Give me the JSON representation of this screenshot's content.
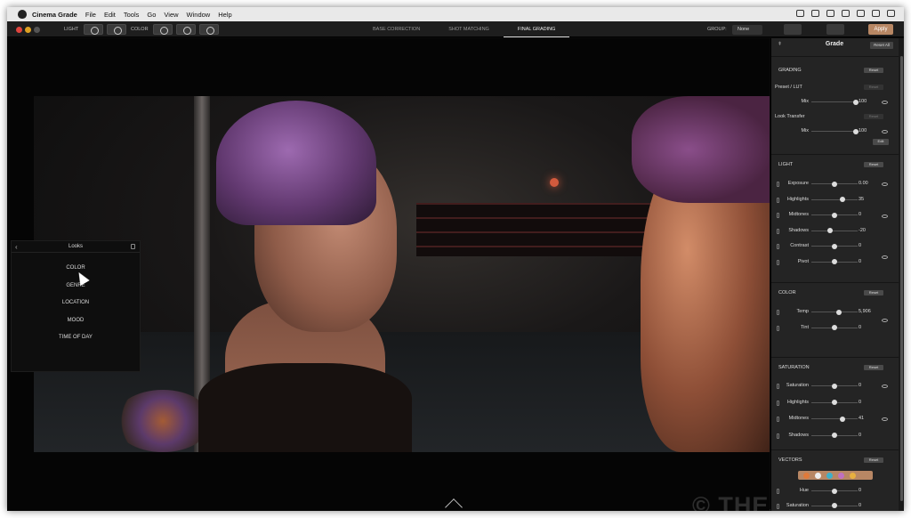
{
  "menubar": {
    "app_name": "Cinema Grade",
    "items": [
      "File",
      "Edit",
      "Tools",
      "Go",
      "View",
      "Window",
      "Help"
    ]
  },
  "toolbar": {
    "light_label": "LIGHT",
    "color_label": "COLOR",
    "tabs": [
      {
        "label": "BASE CORRECTION",
        "active": false
      },
      {
        "label": "SHOT MATCHING",
        "active": false
      },
      {
        "label": "FINAL GRADING",
        "active": true
      }
    ],
    "group_label": "GROUP:",
    "group_value": "None",
    "apply_label": "Apply"
  },
  "looks": {
    "title": "Looks",
    "items": [
      "COLOR",
      "GENRE",
      "LOCATION",
      "MOOD",
      "TIME OF DAY"
    ]
  },
  "watermark": "© THESOFTWARE",
  "panel": {
    "title": "Grade",
    "reset_all": "Reset All",
    "grading": {
      "title": "GRADING",
      "reset": "Reset",
      "preset_lut": "Preset / LUT",
      "preset_reset": "Reset",
      "mix_label": "Mix",
      "mix_value": "100",
      "mix_fraction": 0.96,
      "look_transfer": "Look Transfer",
      "lt_reset": "Reset",
      "lt_mix_label": "Mix",
      "lt_mix_value": "100",
      "lt_mix_fraction": 0.96,
      "edit": "Edit"
    },
    "light": {
      "title": "LIGHT",
      "reset": "Reset",
      "rows": [
        {
          "label": "Exposure",
          "value": "0.00",
          "fraction": 0.5
        },
        {
          "label": "Highlights",
          "value": "35",
          "fraction": 0.68
        },
        {
          "label": "Midtones",
          "value": "0",
          "fraction": 0.5
        },
        {
          "label": "Shadows",
          "value": "-20",
          "fraction": 0.4
        },
        {
          "label": "Contrast",
          "value": "0",
          "fraction": 0.5
        },
        {
          "label": "Pivot",
          "value": "0",
          "fraction": 0.5
        }
      ]
    },
    "color": {
      "title": "COLOR",
      "reset": "Reset",
      "rows": [
        {
          "label": "Temp",
          "value": "5,906",
          "fraction": 0.6
        },
        {
          "label": "Tint",
          "value": "0",
          "fraction": 0.5
        }
      ]
    },
    "saturation": {
      "title": "SATURATION",
      "reset": "Reset",
      "rows": [
        {
          "label": "Saturation",
          "value": "0",
          "fraction": 0.5
        },
        {
          "label": "Highlights",
          "value": "0",
          "fraction": 0.5
        },
        {
          "label": "Midtones",
          "value": "41",
          "fraction": 0.68
        },
        {
          "label": "Shadows",
          "value": "0",
          "fraction": 0.5
        }
      ]
    },
    "vectors": {
      "title": "VECTORS",
      "reset": "Reset",
      "swatch_colors": [
        "#e07a3a",
        "#eeeeee",
        "#3fb0c9",
        "#c070c0",
        "#e8b040"
      ],
      "rows": [
        {
          "label": "Hue",
          "value": "0",
          "fraction": 0.5
        },
        {
          "label": "Saturation",
          "value": "0",
          "fraction": 0.5
        }
      ]
    }
  }
}
